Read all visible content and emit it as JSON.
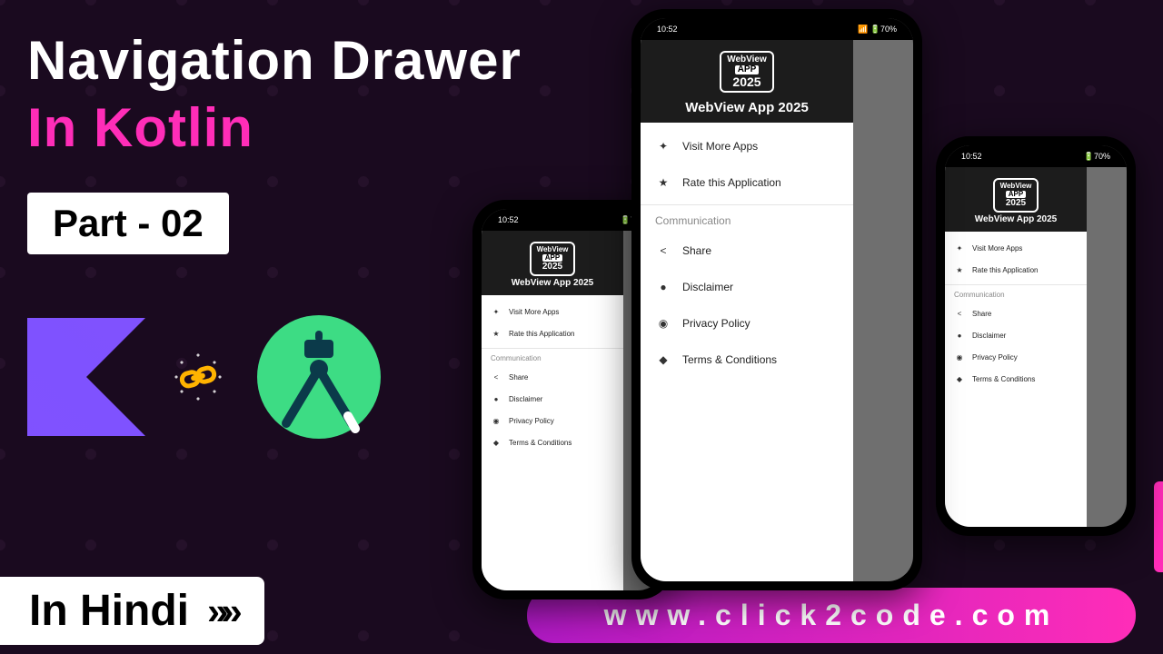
{
  "title_line1": "Navigation Drawer",
  "title_line2": "In Kotlin",
  "part_label": "Part - 02",
  "hindi_label": "In Hindi",
  "url_text": "www.click2code.com",
  "phone": {
    "status_time": "10:52",
    "status_battery": "70%",
    "app_logo_l1": "WebView",
    "app_logo_l2": "APP",
    "app_logo_l3": "2025",
    "app_title": "WebView App 2025",
    "items": {
      "visit": "Visit More Apps",
      "rate": "Rate this Application",
      "section": "Communication",
      "share": "Share",
      "disclaimer": "Disclaimer",
      "privacy": "Privacy Policy",
      "terms": "Terms & Conditions"
    }
  }
}
